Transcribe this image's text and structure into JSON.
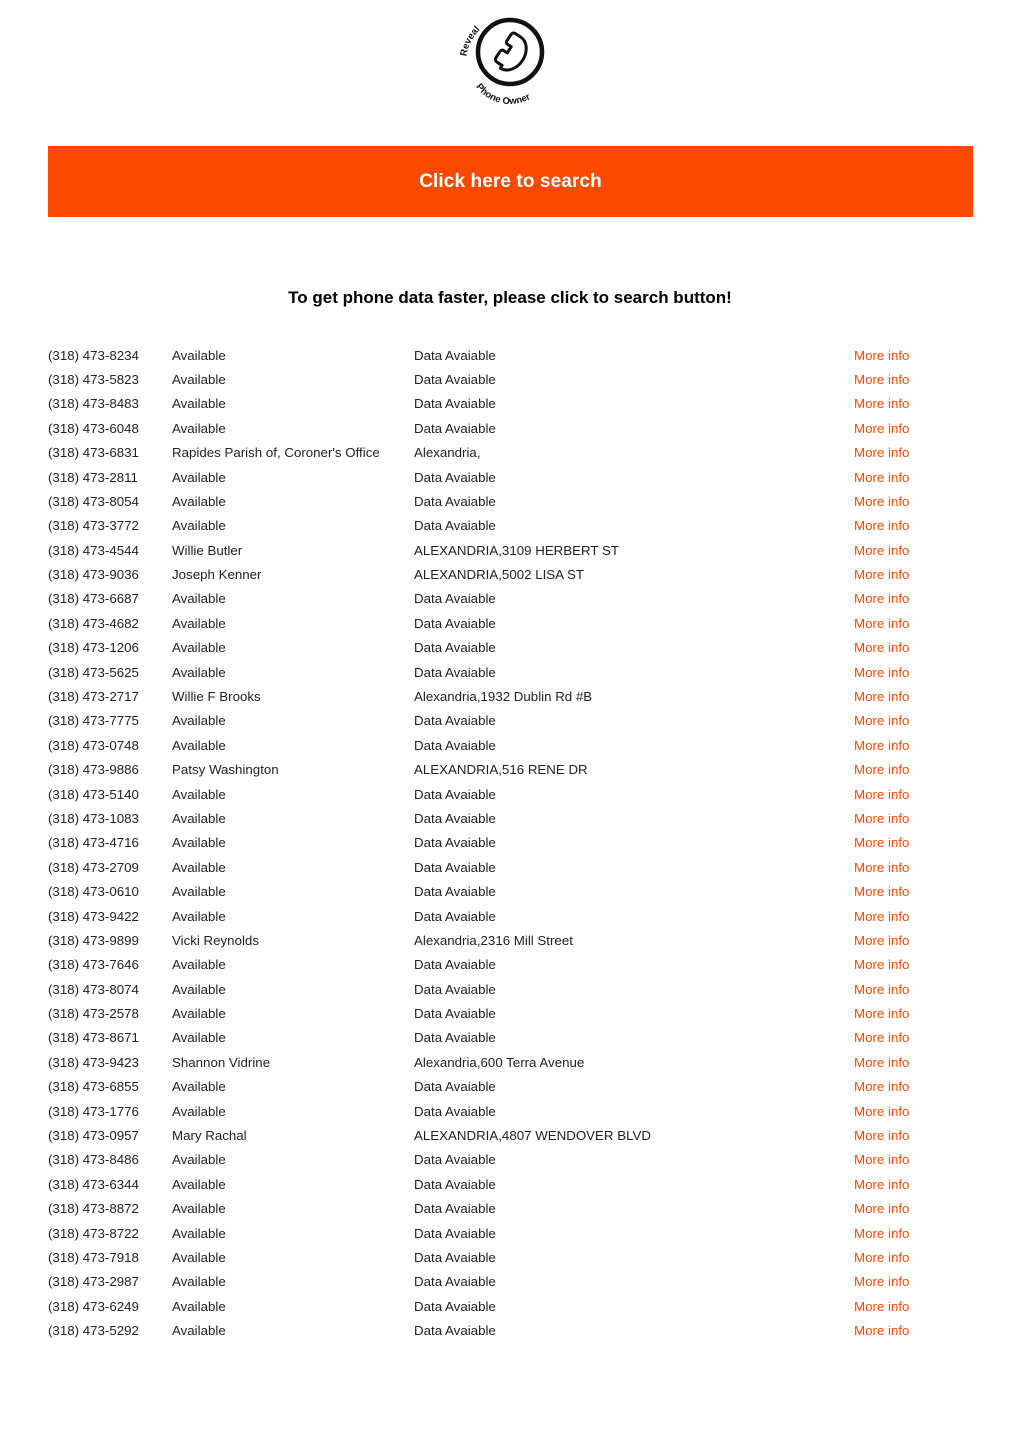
{
  "logo": {
    "icon": "phone-handset-icon",
    "circular_text": "Reveal Phone Owner",
    "text_parts": [
      "Reveal",
      "Phone",
      "Owner"
    ]
  },
  "cta": {
    "label": "Click here to search",
    "background_color": "#fb4a00",
    "text_color": "#ffffff"
  },
  "subheadline": {
    "text": "To get phone data faster, please click to search button!"
  },
  "listing": {
    "link_color": "#fb4a00",
    "link_label": "More info",
    "rows": [
      {
        "phone": "(318) 473-8234",
        "name": "Available",
        "address": "Data Avaiable",
        "link": "More info"
      },
      {
        "phone": "(318) 473-5823",
        "name": "Available",
        "address": "Data Avaiable",
        "link": "More info"
      },
      {
        "phone": "(318) 473-8483",
        "name": "Available",
        "address": "Data Avaiable",
        "link": "More info"
      },
      {
        "phone": "(318) 473-6048",
        "name": "Available",
        "address": "Data Avaiable",
        "link": "More info"
      },
      {
        "phone": "(318) 473-6831",
        "name": "Rapides Parish of, Coroner's Office",
        "address": "Alexandria,",
        "link": "More info"
      },
      {
        "phone": "(318) 473-2811",
        "name": "Available",
        "address": "Data Avaiable",
        "link": "More info"
      },
      {
        "phone": "(318) 473-8054",
        "name": "Available",
        "address": "Data Avaiable",
        "link": "More info"
      },
      {
        "phone": "(318) 473-3772",
        "name": "Available",
        "address": "Data Avaiable",
        "link": "More info"
      },
      {
        "phone": "(318) 473-4544",
        "name": "Willie Butler",
        "address": "ALEXANDRIA,3109 HERBERT ST",
        "link": "More info"
      },
      {
        "phone": "(318) 473-9036",
        "name": "Joseph Kenner",
        "address": "ALEXANDRIA,5002 LISA ST",
        "link": "More info"
      },
      {
        "phone": "(318) 473-6687",
        "name": "Available",
        "address": "Data Avaiable",
        "link": "More info"
      },
      {
        "phone": "(318) 473-4682",
        "name": "Available",
        "address": "Data Avaiable",
        "link": "More info"
      },
      {
        "phone": "(318) 473-1206",
        "name": "Available",
        "address": "Data Avaiable",
        "link": "More info"
      },
      {
        "phone": "(318) 473-5625",
        "name": "Available",
        "address": "Data Avaiable",
        "link": "More info"
      },
      {
        "phone": "(318) 473-2717",
        "name": "Willie F Brooks",
        "address": "Alexandria,1932 Dublin Rd #B",
        "link": "More info"
      },
      {
        "phone": "(318) 473-7775",
        "name": "Available",
        "address": "Data Avaiable",
        "link": "More info"
      },
      {
        "phone": "(318) 473-0748",
        "name": "Available",
        "address": "Data Avaiable",
        "link": "More info"
      },
      {
        "phone": "(318) 473-9886",
        "name": "Patsy Washington",
        "address": "ALEXANDRIA,516 RENE DR",
        "link": "More info"
      },
      {
        "phone": "(318) 473-5140",
        "name": "Available",
        "address": "Data Avaiable",
        "link": "More info"
      },
      {
        "phone": "(318) 473-1083",
        "name": "Available",
        "address": "Data Avaiable",
        "link": "More info"
      },
      {
        "phone": "(318) 473-4716",
        "name": "Available",
        "address": "Data Avaiable",
        "link": "More info"
      },
      {
        "phone": "(318) 473-2709",
        "name": "Available",
        "address": "Data Avaiable",
        "link": "More info"
      },
      {
        "phone": "(318) 473-0610",
        "name": "Available",
        "address": "Data Avaiable",
        "link": "More info"
      },
      {
        "phone": "(318) 473-9422",
        "name": "Available",
        "address": "Data Avaiable",
        "link": "More info"
      },
      {
        "phone": "(318) 473-9899",
        "name": "Vicki Reynolds",
        "address": "Alexandria,2316 Mill Street",
        "link": "More info"
      },
      {
        "phone": "(318) 473-7646",
        "name": "Available",
        "address": "Data Avaiable",
        "link": "More info"
      },
      {
        "phone": "(318) 473-8074",
        "name": "Available",
        "address": "Data Avaiable",
        "link": "More info"
      },
      {
        "phone": "(318) 473-2578",
        "name": "Available",
        "address": "Data Avaiable",
        "link": "More info"
      },
      {
        "phone": "(318) 473-8671",
        "name": "Available",
        "address": "Data Avaiable",
        "link": "More info"
      },
      {
        "phone": "(318) 473-9423",
        "name": "Shannon Vidrine",
        "address": "Alexandria,600 Terra Avenue",
        "link": "More info"
      },
      {
        "phone": "(318) 473-6855",
        "name": "Available",
        "address": "Data Avaiable",
        "link": "More info"
      },
      {
        "phone": "(318) 473-1776",
        "name": "Available",
        "address": "Data Avaiable",
        "link": "More info"
      },
      {
        "phone": "(318) 473-0957",
        "name": "Mary Rachal",
        "address": "ALEXANDRIA,4807 WENDOVER BLVD",
        "link": "More info"
      },
      {
        "phone": "(318) 473-8486",
        "name": "Available",
        "address": "Data Avaiable",
        "link": "More info"
      },
      {
        "phone": "(318) 473-6344",
        "name": "Available",
        "address": "Data Avaiable",
        "link": "More info"
      },
      {
        "phone": "(318) 473-8872",
        "name": "Available",
        "address": "Data Avaiable",
        "link": "More info"
      },
      {
        "phone": "(318) 473-8722",
        "name": "Available",
        "address": "Data Avaiable",
        "link": "More info"
      },
      {
        "phone": "(318) 473-7918",
        "name": "Available",
        "address": "Data Avaiable",
        "link": "More info"
      },
      {
        "phone": "(318) 473-2987",
        "name": "Available",
        "address": "Data Avaiable",
        "link": "More info"
      },
      {
        "phone": "(318) 473-6249",
        "name": "Available",
        "address": "Data Avaiable",
        "link": "More info"
      },
      {
        "phone": "(318) 473-5292",
        "name": "Available",
        "address": "Data Avaiable",
        "link": "More info"
      }
    ]
  }
}
